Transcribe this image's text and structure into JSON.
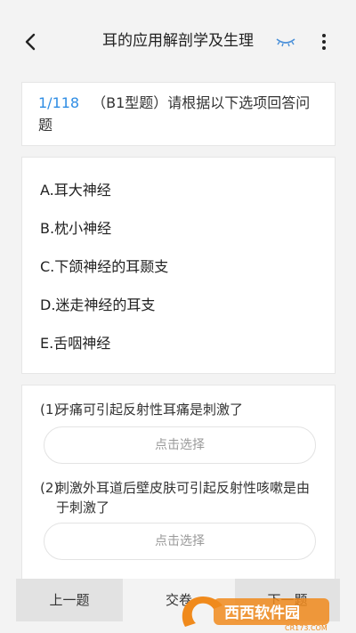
{
  "header": {
    "title": "耳的应用解剖学及生理",
    "back_icon": "back-arrow-icon",
    "eye_icon": "eye-closed-icon",
    "more_icon": "more-vertical-icon"
  },
  "question": {
    "number": "1/118",
    "text": "（B1型题）请根据以下选项回答问题"
  },
  "options": [
    {
      "label": "A.耳大神经"
    },
    {
      "label": "B.枕小神经"
    },
    {
      "label": "C.下颌神经的耳颞支"
    },
    {
      "label": "D.迷走神经的耳支"
    },
    {
      "label": "E.舌咽神经"
    }
  ],
  "sub_questions": [
    {
      "num": "(1)",
      "text": "牙痛可引起反射性耳痛是刺激了",
      "select_label": "点击选择"
    },
    {
      "num": "(2)",
      "text": "刺激外耳道后壁皮肤可引起反射性咳嗽是由于刺激了",
      "select_label": "点击选择"
    }
  ],
  "footer": {
    "prev_label": "上一题",
    "submit_label": "交卷",
    "next_label": "下一题"
  },
  "watermark": {
    "brand": "西西软件园",
    "url": "CR173.COM"
  },
  "colors": {
    "accent": "#2f8de4",
    "background": "#f3f3f3",
    "button_gray": "#e2e2e2",
    "watermark_orange": "#f08a1c"
  }
}
